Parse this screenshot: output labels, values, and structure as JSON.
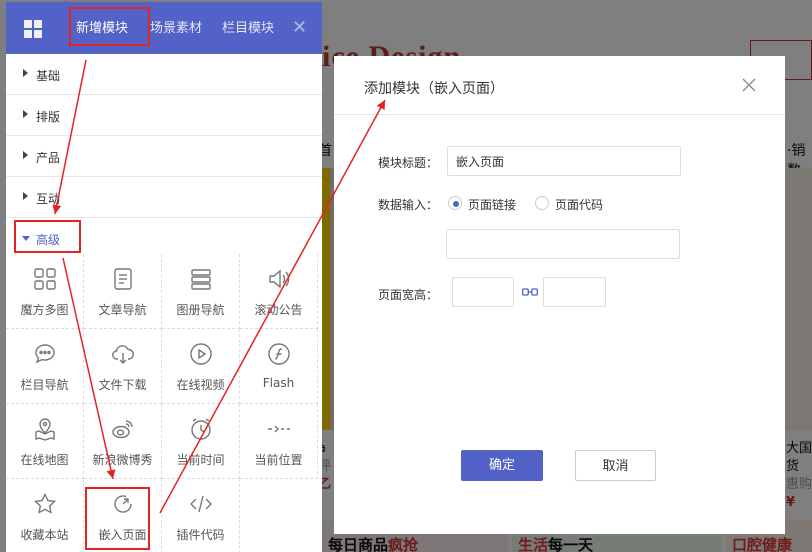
{
  "background_page": {
    "logo": "ice Design",
    "nav_left": "首",
    "nav_right": "·销数",
    "product_left": {
      "line1": "a",
      "line2": "评",
      "line3": "乙"
    },
    "product_right": {
      "line1": "大国货",
      "line2": "惠购",
      "line3": "¥"
    },
    "section1": {
      "pre": "每日商品",
      "em": "疯抢"
    },
    "section2": {
      "pre": "生活",
      "em": "每一天"
    },
    "section3": {
      "pre": "口腔健康"
    }
  },
  "panel": {
    "tabs": {
      "new_module": "新增模块",
      "scene_material": "场景素材",
      "column_module": "栏目模块"
    },
    "close_glyph": "✕",
    "categories": [
      "基础",
      "排版",
      "产品",
      "互动"
    ],
    "advanced": "高级",
    "modules": [
      {
        "label": "魔方多图",
        "icon": "cube-grid-icon"
      },
      {
        "label": "文章导航",
        "icon": "article-list-icon"
      },
      {
        "label": "图册导航",
        "icon": "album-icon"
      },
      {
        "label": "滚动公告",
        "icon": "speaker-icon"
      },
      {
        "label": "栏目导航",
        "icon": "chat-bubble-icon"
      },
      {
        "label": "文件下载",
        "icon": "cloud-download-icon"
      },
      {
        "label": "在线视频",
        "icon": "play-circle-icon"
      },
      {
        "label": "Flash",
        "icon": "flash-icon"
      },
      {
        "label": "在线地图",
        "icon": "map-pin-icon"
      },
      {
        "label": "新浪微博秀",
        "icon": "weibo-icon"
      },
      {
        "label": "当前时间",
        "icon": "clock-icon"
      },
      {
        "label": "当前位置",
        "icon": "location-arrow-icon"
      },
      {
        "label": "收藏本站",
        "icon": "star-icon"
      },
      {
        "label": "嵌入页面",
        "icon": "embed-page-icon"
      },
      {
        "label": "插件代码",
        "icon": "code-icon"
      }
    ]
  },
  "dialog": {
    "title": "添加模块（嵌入页面）",
    "module_title_label": "模块标题：",
    "module_title_value": "嵌入页面",
    "data_input_label": "数据输入：",
    "option_url": "页面链接",
    "option_code": "页面代码",
    "selected_option": "页面链接",
    "url_value": "",
    "size_label": "页面宽高：",
    "width_value": "",
    "height_value": "",
    "ok": "确定",
    "cancel": "取消"
  },
  "colors": {
    "accent": "#5362c7",
    "annotation": "#e12525"
  }
}
